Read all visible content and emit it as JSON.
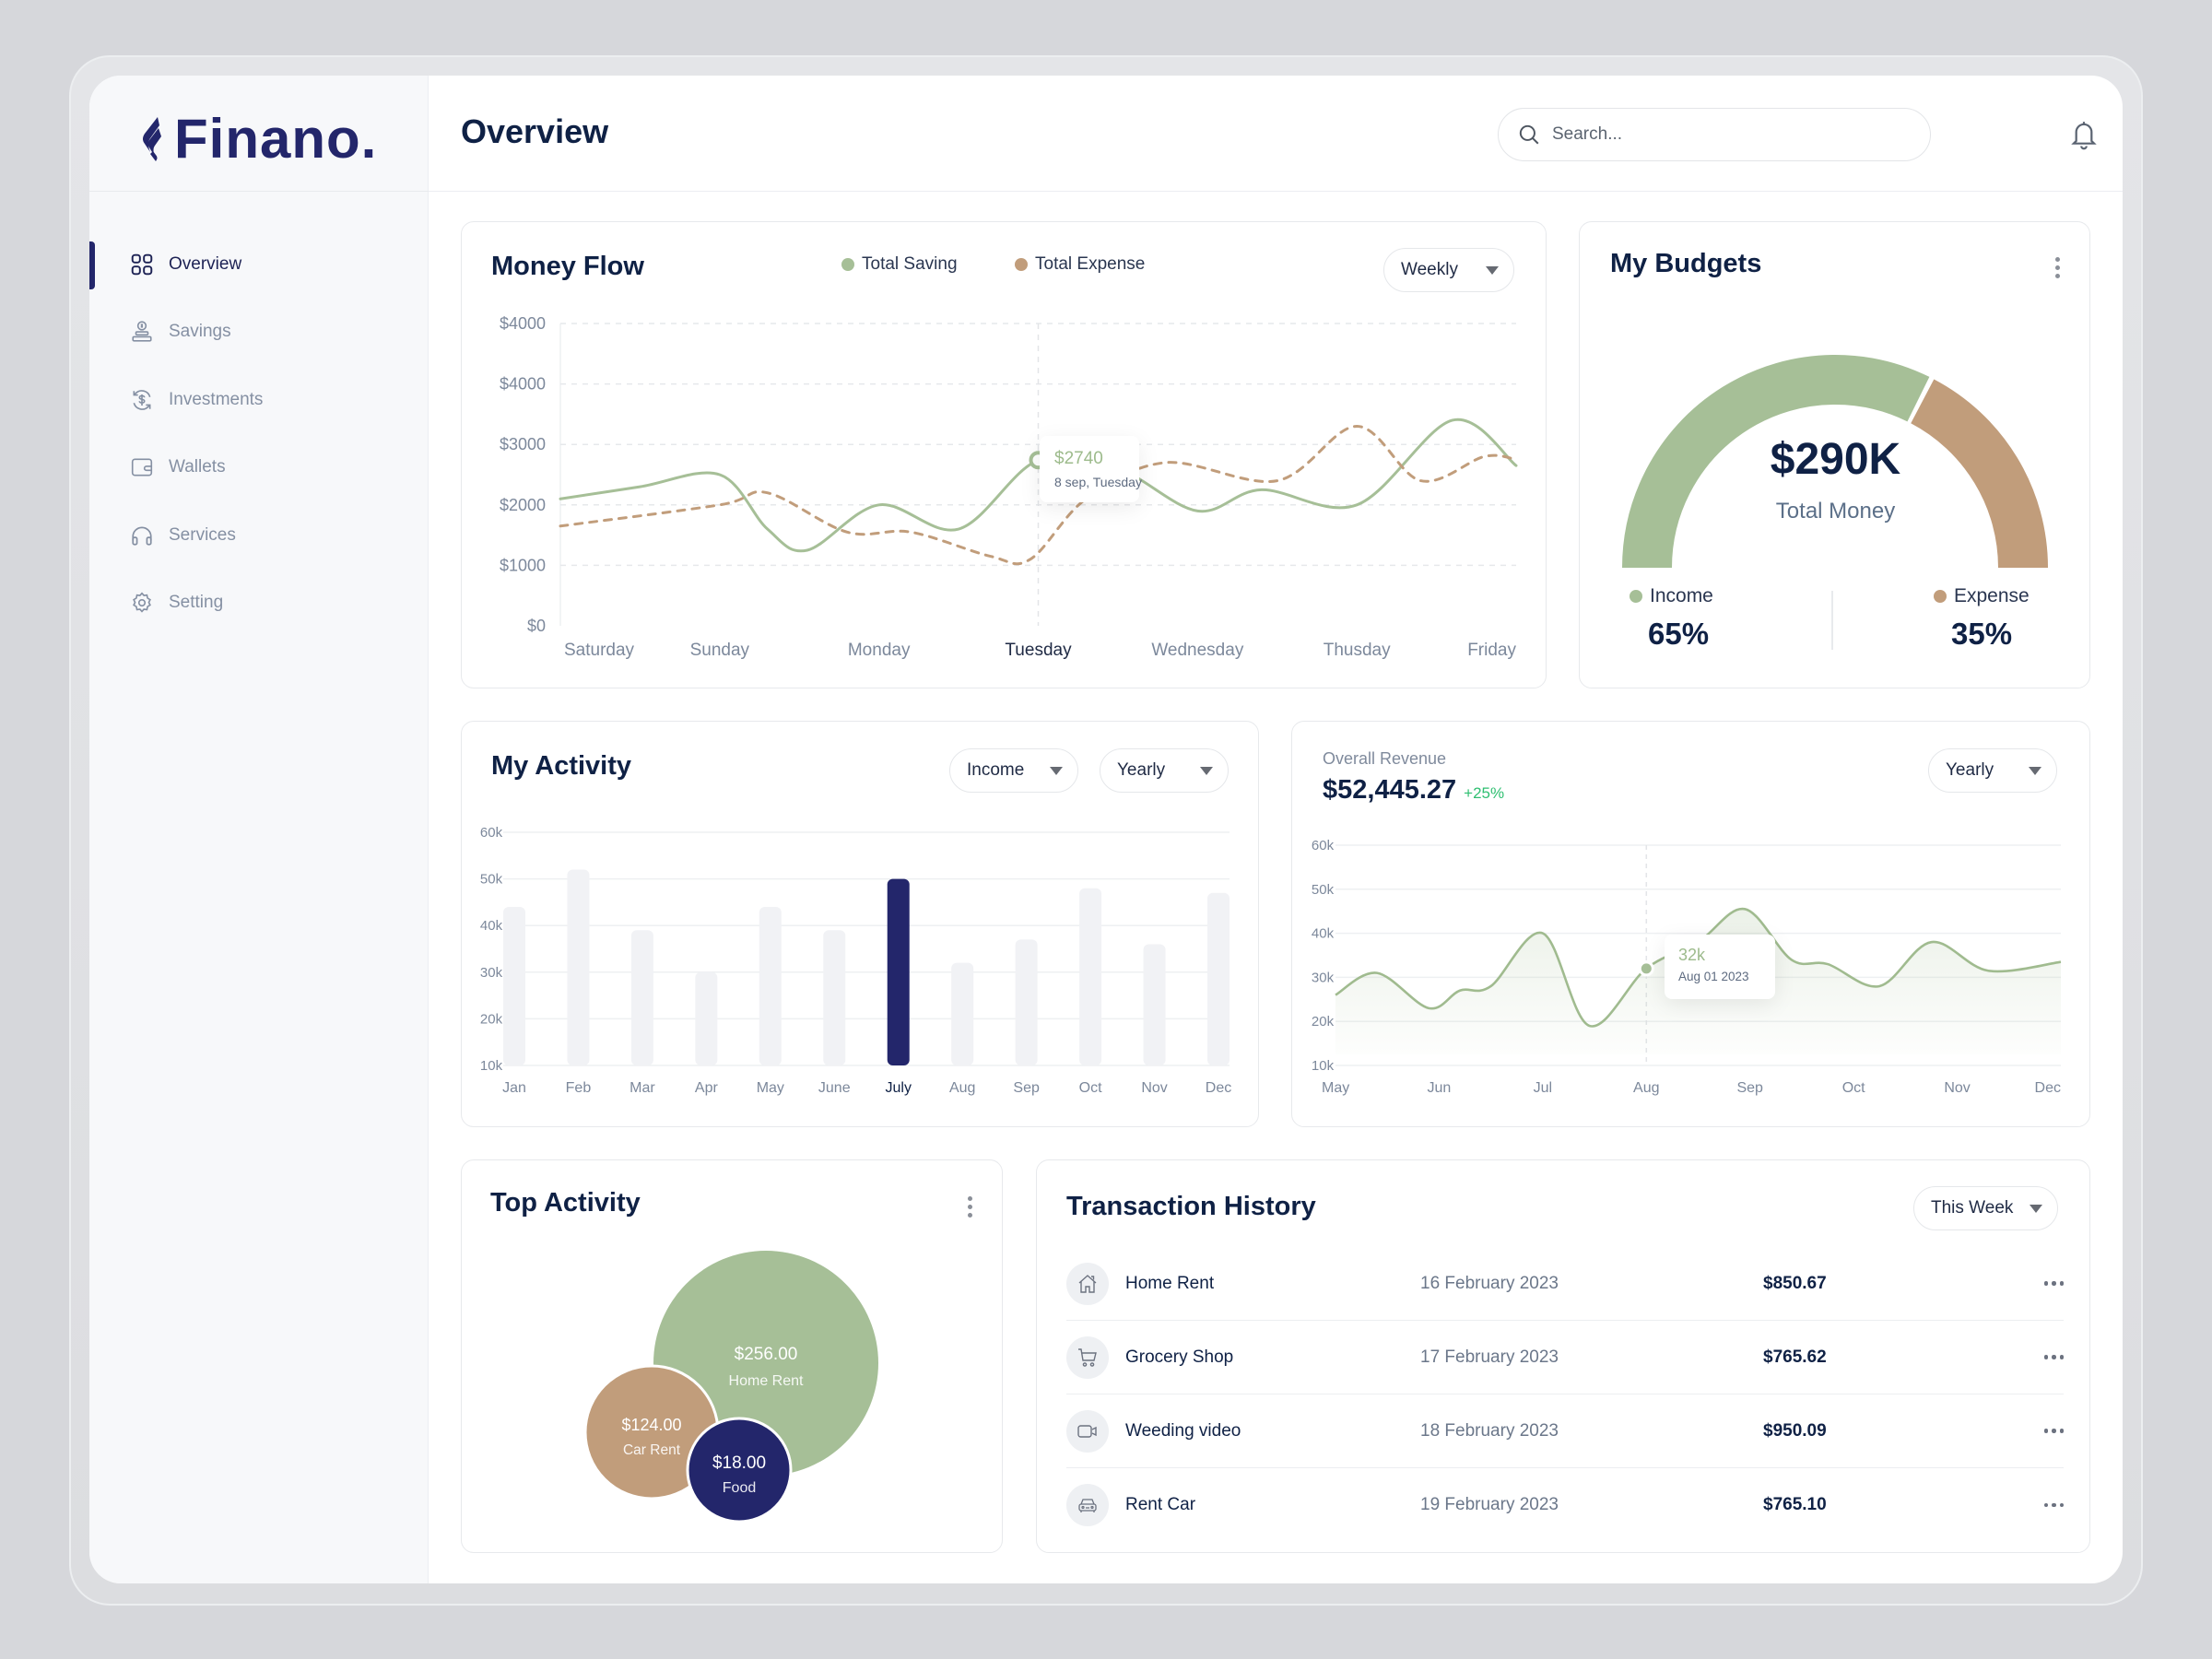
{
  "app": {
    "brand": "Finano.",
    "page_title": "Overview"
  },
  "colors": {
    "navy": "#23266b",
    "sage": "#a6bf97",
    "tan": "#c19d7b",
    "positive": "#2fbf71",
    "text_dark": "#0f2145"
  },
  "sidebar": {
    "items": [
      {
        "label": "Overview",
        "icon": "grid-icon",
        "active": true
      },
      {
        "label": "Savings",
        "icon": "savings-icon",
        "active": false
      },
      {
        "label": "Investments",
        "icon": "investment-icon",
        "active": false
      },
      {
        "label": "Wallets",
        "icon": "wallet-icon",
        "active": false
      },
      {
        "label": "Services",
        "icon": "headphones-icon",
        "active": false
      },
      {
        "label": "Setting",
        "icon": "gear-icon",
        "active": false
      }
    ]
  },
  "header": {
    "search_placeholder": "Search...",
    "notification_icon": "bell-icon",
    "avatar_icon": "user-avatar"
  },
  "money_flow": {
    "title": "Money Flow",
    "period": "Weekly",
    "tooltip": {
      "value": "$2740",
      "label": "8 sep, Tuesday"
    }
  },
  "budgets": {
    "title": "My Budgets",
    "total": "$290K",
    "total_label": "Total Money",
    "income_label": "Income",
    "income_pct": "65%",
    "expense_label": "Expense",
    "expense_pct": "35%"
  },
  "activity": {
    "title": "My Activity",
    "type_filter": "Income",
    "period": "Yearly"
  },
  "revenue": {
    "label": "Overall Revenue",
    "amount": "$52,445.27",
    "change": "+25%",
    "period": "Yearly",
    "tooltip": {
      "value": "32k",
      "label": "Aug 01 2023"
    }
  },
  "top_activity": {
    "title": "Top Activity",
    "bubbles": [
      {
        "amount": "$256.00",
        "label": "Home Rent"
      },
      {
        "amount": "$124.00",
        "label": "Car Rent"
      },
      {
        "amount": "$18.00",
        "label": "Food"
      }
    ]
  },
  "transactions": {
    "title": "Transaction History",
    "period": "This Week",
    "rows": [
      {
        "icon": "home-icon",
        "name": "Home Rent",
        "date": "16 February 2023",
        "amount": "$850.67"
      },
      {
        "icon": "cart-icon",
        "name": "Grocery Shop",
        "date": "17 February 2023",
        "amount": "$765.62"
      },
      {
        "icon": "video-icon",
        "name": "Weeding video",
        "date": "18 February 2023",
        "amount": "$950.09"
      },
      {
        "icon": "car-icon",
        "name": "Rent Car",
        "date": "19 February 2023",
        "amount": "$765.10"
      }
    ]
  },
  "chart_data": [
    {
      "id": "money_flow",
      "type": "line",
      "title": "Money Flow",
      "categories": [
        "Saturday",
        "Sunday",
        "Monday",
        "Tuesday",
        "Wednesday",
        "Thusday",
        "Friday"
      ],
      "highlight_category": "Tuesday",
      "y_ticks": [
        "$0",
        "$1000",
        "$2000",
        "$3000",
        "$4000",
        "$4000"
      ],
      "ylim": [
        0,
        5000
      ],
      "grid": true,
      "legend_position": "top-center",
      "series": [
        {
          "name": "Total Saving",
          "color": "#a6bf97",
          "style": "solid",
          "x": [
            0,
            0.5,
            1,
            1.3,
            1.55,
            2,
            2.5,
            3,
            3.5,
            4,
            4.4,
            5,
            5.6,
            6
          ],
          "values": [
            2100,
            2300,
            2500,
            1600,
            1250,
            2000,
            1600,
            2740,
            2600,
            1900,
            2250,
            2000,
            3400,
            2650
          ]
        },
        {
          "name": "Total Expense",
          "color": "#c19d7b",
          "style": "dashed",
          "x": [
            0,
            1.0,
            1.3,
            1.8,
            2.2,
            2.7,
            2.95,
            3.3,
            3.8,
            4.5,
            5,
            5.4,
            5.8,
            6
          ],
          "values": [
            1650,
            2000,
            2200,
            1550,
            1550,
            1150,
            1100,
            2100,
            2700,
            2400,
            3300,
            2400,
            2800,
            2750
          ]
        }
      ],
      "tooltip": {
        "category": "Tuesday",
        "value": 2740
      }
    },
    {
      "id": "budgets",
      "type": "pie",
      "title": "My Budgets",
      "style": "semicircle-gauge",
      "slices": [
        {
          "label": "Income",
          "value": 65,
          "color": "#a6bf97"
        },
        {
          "label": "Expense",
          "value": 35,
          "color": "#c19d7b"
        }
      ],
      "center_value": "$290K",
      "center_label": "Total Money"
    },
    {
      "id": "activity",
      "type": "bar",
      "title": "My Activity",
      "categories": [
        "Jan",
        "Feb",
        "Mar",
        "Apr",
        "May",
        "June",
        "July",
        "Aug",
        "Sep",
        "Oct",
        "Nov",
        "Dec"
      ],
      "values": [
        44,
        52,
        39,
        30,
        44,
        39,
        50,
        32,
        37,
        48,
        36,
        47
      ],
      "unit": "k",
      "highlight_category": "July",
      "y_ticks": [
        "10k",
        "20k",
        "30k",
        "40k",
        "50k",
        "60k"
      ],
      "ylim": [
        10,
        60
      ],
      "grid": true
    },
    {
      "id": "revenue",
      "type": "area",
      "title": "Overall Revenue",
      "categories": [
        "May",
        "Jun",
        "Jul",
        "Aug",
        "Sep",
        "Oct",
        "Nov",
        "Dec"
      ],
      "x": [
        0,
        0.4,
        0.9,
        1.2,
        1.5,
        2.0,
        2.45,
        3.0,
        3.5,
        3.95,
        4.4,
        4.75,
        5.25,
        5.75,
        6.3,
        7.0
      ],
      "values": [
        26,
        31,
        23,
        27,
        28,
        40,
        19,
        32,
        38,
        45.5,
        34,
        33,
        28,
        38,
        31.5,
        33.5
      ],
      "unit": "k",
      "y_ticks": [
        "10k",
        "20k",
        "30k",
        "40k",
        "50k",
        "60k"
      ],
      "ylim": [
        10,
        60
      ],
      "grid": true,
      "tooltip": {
        "category": "Aug",
        "value": 32,
        "label": "Aug 01 2023"
      }
    },
    {
      "id": "top_activity",
      "type": "scatter",
      "style": "bubble",
      "title": "Top Activity",
      "points": [
        {
          "label": "Home Rent",
          "value": 256.0,
          "color": "#a6bf97"
        },
        {
          "label": "Car Rent",
          "value": 124.0,
          "color": "#c19d7b"
        },
        {
          "label": "Food",
          "value": 18.0,
          "color": "#23266b"
        }
      ]
    }
  ]
}
